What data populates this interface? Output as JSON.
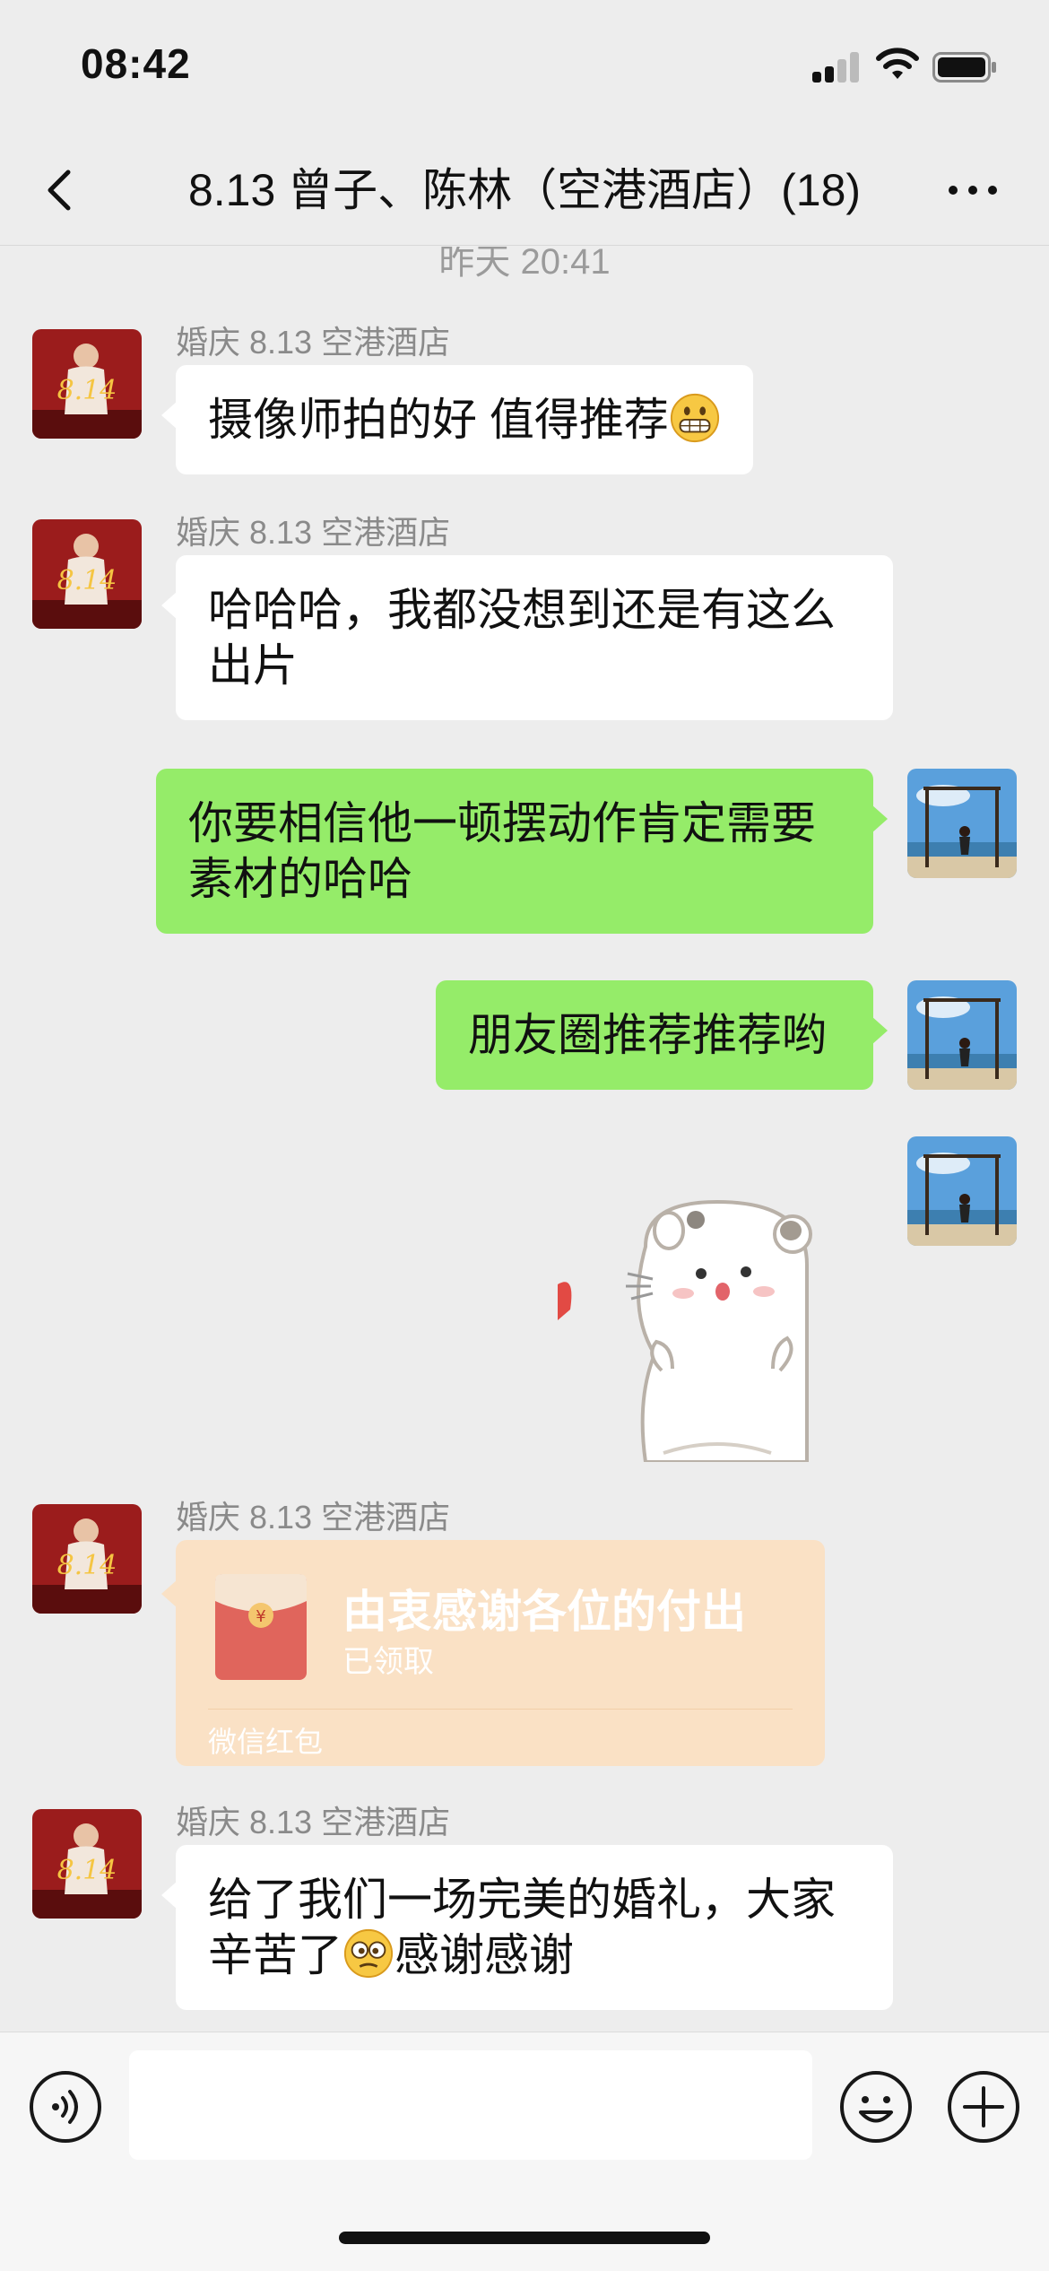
{
  "status_bar": {
    "time": "08:42"
  },
  "nav": {
    "title": "8.13 曾子、陈林（空港酒店）(18)"
  },
  "chat": {
    "timestamp": "昨天 20:41",
    "messages": [
      {
        "sender": "婚庆 8.13 空港酒店",
        "text": "摄像师拍的好 值得推荐",
        "emoji": "grinning-face-emoji"
      },
      {
        "sender": "婚庆 8.13 空港酒店",
        "line1": "哈哈哈，我都没想到还是有这么",
        "line2": "出片"
      },
      {
        "line1": "你要相信他一顿摆动作肯定需要",
        "line2": "素材的哈哈"
      },
      {
        "text": "朋友圈推荐推荐哟"
      },
      {
        "sticker": "hamster-sticker"
      },
      {
        "sender": "婚庆 8.13 空港酒店",
        "red_packet": {
          "title": "由衷感谢各位的付出",
          "status": "已领取",
          "footer": "微信红包"
        }
      },
      {
        "sender": "婚庆 8.13 空港酒店",
        "line1": "给了我们一场完美的婚礼，大家",
        "line2_a": "辛苦了",
        "line2_b": "感谢感谢",
        "emoji": "grimace-face-emoji"
      }
    ]
  },
  "colors": {
    "outgoing_bubble": "#95ec69",
    "incoming_bubble": "#ffffff",
    "red_packet": "#fae1c5",
    "background": "#ededed"
  }
}
